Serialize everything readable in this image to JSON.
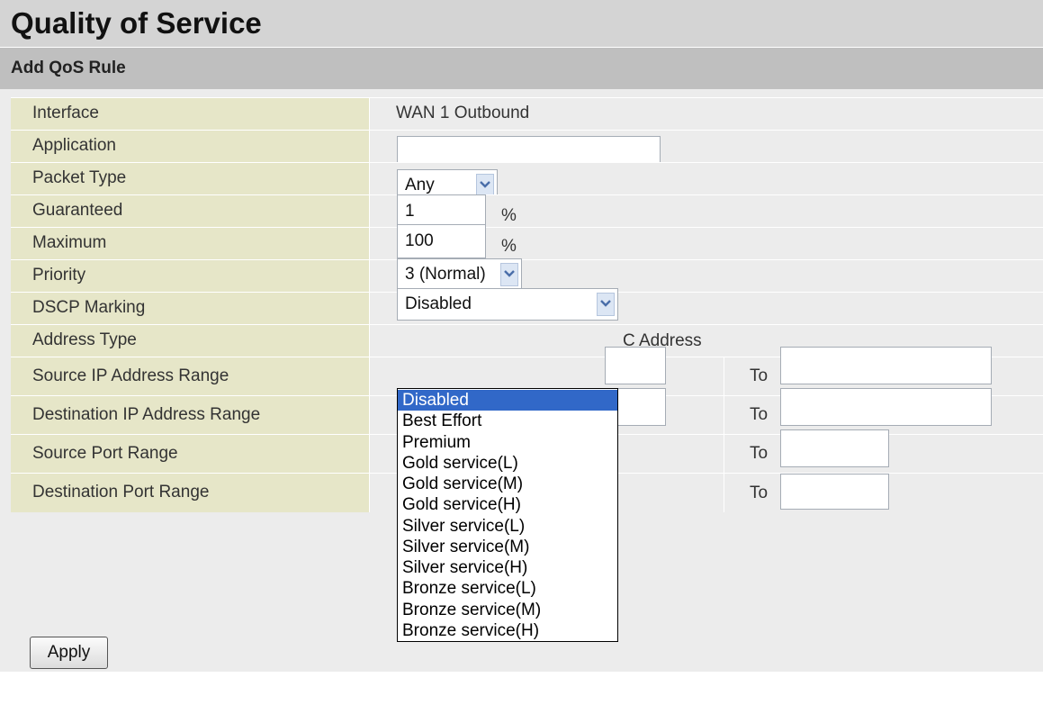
{
  "page": {
    "title": "Quality of Service",
    "section_title": "Add QoS Rule"
  },
  "form": {
    "interface": {
      "label": "Interface",
      "value": "WAN 1 Outbound"
    },
    "application": {
      "label": "Application",
      "value": ""
    },
    "packet_type": {
      "label": "Packet Type",
      "selected": "Any"
    },
    "guaranteed": {
      "label": "Guaranteed",
      "value": "1",
      "unit": "%"
    },
    "maximum": {
      "label": "Maximum",
      "value": "100",
      "unit": "%"
    },
    "priority": {
      "label": "Priority",
      "selected": "3 (Normal)"
    },
    "dscp_marking": {
      "label": "DSCP Marking",
      "selected": "Disabled",
      "options": [
        "Disabled",
        "Best Effort",
        "Premium",
        "Gold service(L)",
        "Gold service(M)",
        "Gold service(H)",
        "Silver service(L)",
        "Silver service(M)",
        "Silver service(H)",
        "Bronze service(L)",
        "Bronze service(M)",
        "Bronze service(H)"
      ]
    },
    "address_type": {
      "label": "Address Type",
      "value_fragment": "C Address"
    },
    "source_ip_range": {
      "label": "Source IP Address Range",
      "to_label": "To",
      "from": "",
      "to": ""
    },
    "destination_ip_range": {
      "label": "Destination IP Address Range",
      "to_label": "To",
      "from": "",
      "to": ""
    },
    "source_port_range": {
      "label": "Source Port Range",
      "to_label": "To",
      "to": ""
    },
    "destination_port_range": {
      "label": "Destination Port Range",
      "to_label": "To",
      "to": ""
    }
  },
  "actions": {
    "apply_label": "Apply"
  },
  "colors": {
    "title_bar_bg": "#d4d4d4",
    "section_bar_bg": "#bfbfbf",
    "label_cell_bg": "#e6e6c8",
    "value_cell_bg": "#ececec",
    "selected_option_bg": "#3168c8"
  },
  "icons": {
    "select_arrow": "chevron-down-icon"
  }
}
